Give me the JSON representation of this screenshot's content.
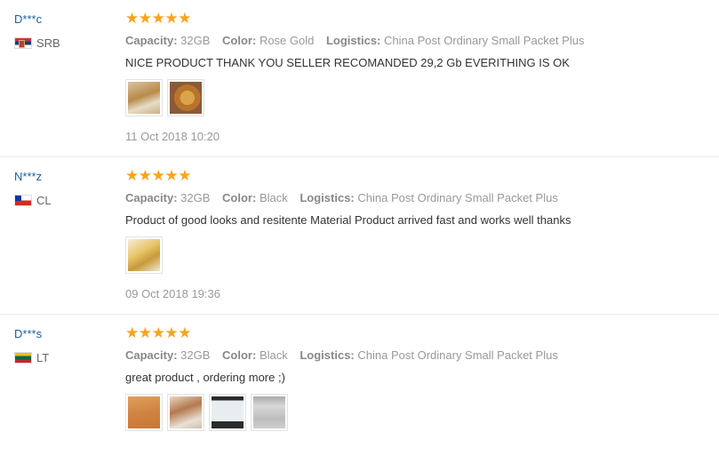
{
  "reviews": [
    {
      "buyer": "D***c",
      "country": "SRB",
      "flag_icon": "serbia-flag-icon",
      "rating": 5,
      "capacity_label": "Capacity:",
      "capacity": "32GB",
      "color_label": "Color:",
      "color": "Rose Gold",
      "logistics_label": "Logistics:",
      "logistics": "China Post Ordinary Small Packet Plus",
      "text": "NICE PRODUCT THANK YOU SELLER RECOMANDED 29,2 Gb EVERITHING IS OK",
      "photo_count": 2,
      "date": "11 Oct 2018 10:20"
    },
    {
      "buyer": "N***z",
      "country": "CL",
      "flag_icon": "chile-flag-icon",
      "rating": 5,
      "capacity_label": "Capacity:",
      "capacity": "32GB",
      "color_label": "Color:",
      "color": "Black",
      "logistics_label": "Logistics:",
      "logistics": "China Post Ordinary Small Packet Plus",
      "text": "Product of good looks and resitente Material Product arrived fast and works well thanks",
      "photo_count": 1,
      "date": "09 Oct 2018 19:36"
    },
    {
      "buyer": "D***s",
      "country": "LT",
      "flag_icon": "lithuania-flag-icon",
      "rating": 5,
      "capacity_label": "Capacity:",
      "capacity": "32GB",
      "color_label": "Color:",
      "color": "Black",
      "logistics_label": "Logistics:",
      "logistics": "China Post Ordinary Small Packet Plus",
      "text": "great product , ordering more ;)",
      "photo_count": 4,
      "date": ""
    }
  ],
  "colors": {
    "star": "#f7a41d",
    "buyer_name": "#1b5f9e",
    "muted_text": "#999999"
  }
}
